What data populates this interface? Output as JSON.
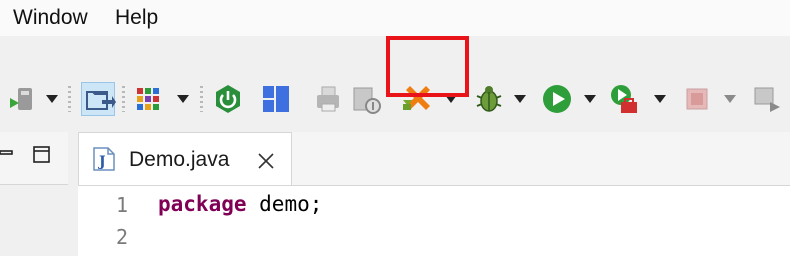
{
  "menubar": {
    "items": [
      "Window",
      "Help"
    ]
  },
  "toolbar": {
    "buttons": [
      {
        "name": "run-last-tool-button",
        "icon": "external-tool-icon"
      },
      {
        "name": "open-type-button",
        "icon": "folder-arrow-icon"
      },
      {
        "name": "grid-view-button",
        "icon": "grid-icon"
      },
      {
        "name": "spring-boot-button",
        "icon": "power-icon"
      },
      {
        "name": "perspective-layout-button",
        "icon": "layout-icon"
      },
      {
        "name": "print-button",
        "icon": "printer-icon"
      },
      {
        "name": "server-button",
        "icon": "server-icon"
      },
      {
        "name": "highlighted-tool-button",
        "icon": "orange-puzzle-icon"
      },
      {
        "name": "debug-button",
        "icon": "bug-icon"
      },
      {
        "name": "run-button",
        "icon": "play-icon"
      },
      {
        "name": "run-external-button",
        "icon": "run-toolbox-icon"
      },
      {
        "name": "stop-button",
        "icon": "stop-icon"
      },
      {
        "name": "next-annotation-button",
        "icon": "arrow-icon"
      }
    ],
    "highlight_color": "#e8141a"
  },
  "editor": {
    "tab": {
      "label": "Demo.java",
      "icon": "java-file-icon"
    },
    "lines": [
      {
        "number": "1",
        "keyword": "package",
        "rest": " demo;"
      },
      {
        "number": "2",
        "keyword": "",
        "rest": ""
      }
    ],
    "keyword_color": "#7f0055"
  }
}
